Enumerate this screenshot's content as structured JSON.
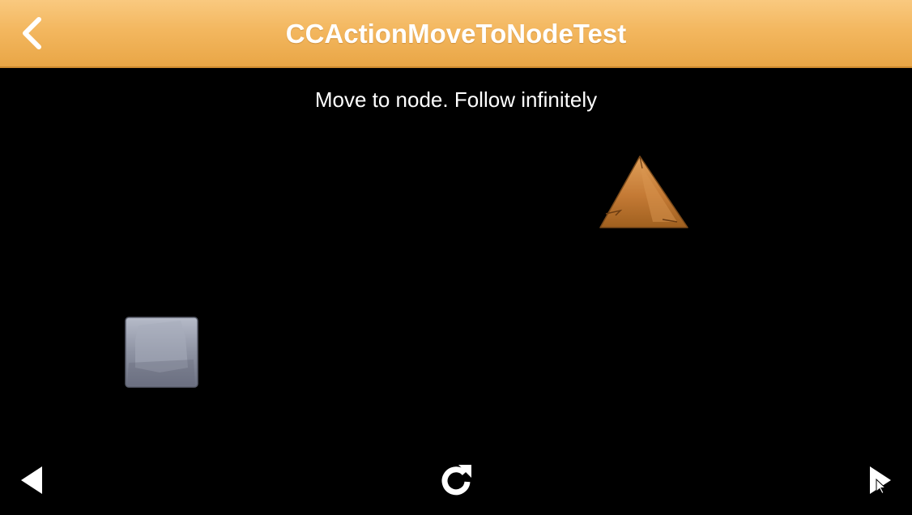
{
  "header": {
    "title": "CCActionMoveToNodeTest",
    "back_icon": "chevron-left-icon",
    "bar_color": "#f3b75f"
  },
  "scene": {
    "subtitle": "Move to node. Follow infinitely",
    "background_color": "#000000",
    "sprites": [
      {
        "name": "triangle-sprite",
        "color": "#c47a35"
      },
      {
        "name": "square-sprite",
        "color": "#8e93a3"
      }
    ]
  },
  "footer": {
    "previous_icon": "triangle-left-icon",
    "restart_icon": "restart-icon",
    "next_icon": "triangle-right-icon"
  }
}
